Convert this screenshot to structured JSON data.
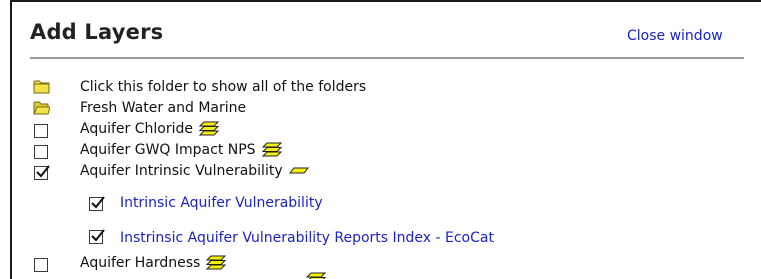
{
  "panel": {
    "title": "Add Layers",
    "close_label": "Close window"
  },
  "rows": [
    {
      "type": "folder",
      "label": "Click this folder to show all of the folders",
      "folder_state": "closed"
    },
    {
      "type": "folder",
      "label": "Fresh Water and Marine",
      "folder_state": "open"
    },
    {
      "type": "layer",
      "label": "Aquifer Chloride",
      "checked": false,
      "icon": "stacked-layers-icon"
    },
    {
      "type": "layer",
      "label": "Aquifer GWQ Impact NPS",
      "checked": false,
      "icon": "stacked-layers-icon"
    },
    {
      "type": "layer",
      "label": "Aquifer Intrinsic Vulnerability",
      "checked": true,
      "icon": "single-layer-icon"
    },
    {
      "type": "sublayer",
      "label": "Intrinsic Aquifer Vulnerability",
      "checked": true
    },
    {
      "type": "sublayer",
      "label": "Instrinsic Aquifer Vulnerability Reports Index - EcoCat",
      "checked": true
    },
    {
      "type": "layer",
      "label": "Aquifer Hardness",
      "checked": false,
      "icon": "stacked-layers-icon"
    }
  ],
  "colors": {
    "link": "#1a22cc",
    "folder_fill": "#f2e24a",
    "layer_icon_fill": "#f5ef10"
  }
}
